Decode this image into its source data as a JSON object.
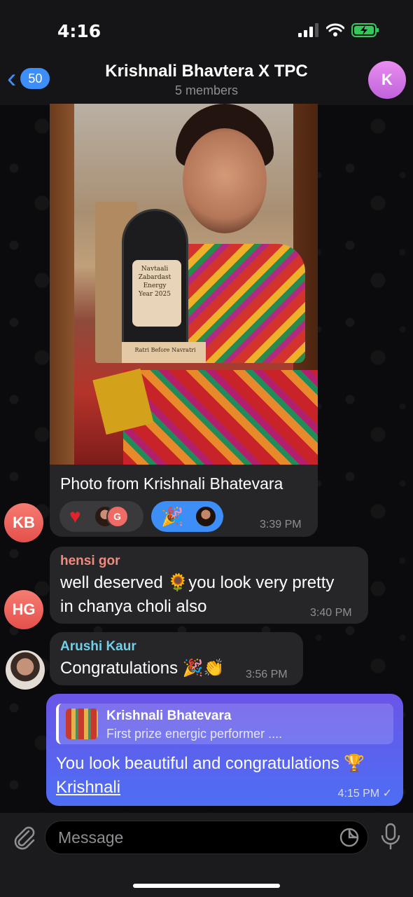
{
  "status_bar": {
    "time": "4:16"
  },
  "header": {
    "back_count": "50",
    "title": "Krishnali Bhavtera X TPC",
    "subtitle": "5 members",
    "avatar_initial": "K"
  },
  "messages": [
    {
      "type": "photo",
      "sender_initials": "KB",
      "trophy_lines": [
        "Navtaali",
        "Zabardast",
        "Energy",
        "Year 2025",
        "Ratri Before Navratri"
      ],
      "caption": "Photo from Krishnali Bhatevara",
      "reactions": [
        {
          "emoji": "heart",
          "users": [
            "A",
            "G"
          ]
        },
        {
          "emoji": "party-popper",
          "users": [
            "A"
          ]
        }
      ],
      "time": "3:39 PM"
    },
    {
      "type": "text",
      "sender": "hensi gor",
      "sender_color": "#f08a80",
      "sender_initials": "HG",
      "lines": [
        "well deserved 🌻you look very pretty",
        "in chanya choli also"
      ],
      "time": "3:40 PM"
    },
    {
      "type": "text",
      "sender": "Arushi Kaur",
      "sender_color": "#6fd0e8",
      "text": "Congratulations 🎉👏",
      "time": "3:56 PM"
    },
    {
      "type": "outgoing",
      "reply_name": "Krishnali Bhatevara",
      "reply_text": "First prize energic performer ....",
      "text": "You look beautiful and congratulations 🏆",
      "link": "Krishnali",
      "time": "4:15 PM"
    }
  ],
  "composer": {
    "placeholder": "Message"
  },
  "colors": {
    "accent": "#3e8ef7",
    "outgoing_bubble": "#5a62ee",
    "incoming_bubble": "#262628"
  }
}
